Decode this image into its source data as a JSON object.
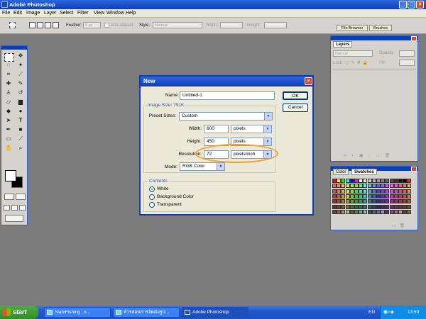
{
  "window": {
    "title": "Adobe Photoshop",
    "minimize": "_",
    "maximize": "□",
    "close": "×"
  },
  "menu": [
    "File",
    "Edit",
    "Image",
    "Layer",
    "Select",
    "Filter",
    "View",
    "Window",
    "Help"
  ],
  "options": {
    "feather_label": "Feather:",
    "feather_value": "0 px",
    "antialiased_label": "Anti-aliased",
    "style_label": "Style:",
    "style_value": "Normal",
    "width_label": "Width:",
    "height_label": "Height:",
    "tab_file_browser": "File Browser",
    "tab_brushes": "Brushes"
  },
  "dialog": {
    "title": "New",
    "name_label": "Name:",
    "name_value": "Untitled-1",
    "image_size_legend": "Image Size: 791K",
    "preset_label": "Preset Sizes:",
    "preset_value": "Custom",
    "width_label": "Width:",
    "width_value": "600",
    "width_unit": "pixels",
    "height_label": "Height:",
    "height_value": "450",
    "height_unit": "pixels",
    "resolution_label": "Resolution:",
    "resolution_value": "72",
    "resolution_unit": "pixels/inch",
    "mode_label": "Mode:",
    "mode_value": "RGB Color",
    "contents_legend": "Contents",
    "contents_options": [
      {
        "label": "White",
        "checked": true
      },
      {
        "label": "Background Color",
        "checked": false
      },
      {
        "label": "Transparent",
        "checked": false
      }
    ],
    "ok_label": "OK",
    "cancel_label": "Cancel"
  },
  "layers_palette": {
    "tab": "Layers",
    "blend_mode": "Normal",
    "opacity_label": "Opacity:",
    "lock_label": "Lock:",
    "fill_label": "Fill:"
  },
  "swatches_palette": {
    "tab_color": "Color",
    "tab_swatches": "Swatches"
  },
  "colors": {
    "accent": "#0a3fb8",
    "highlight": "#f0a030",
    "workspace": "#7c7c7c"
  },
  "taskbar": {
    "start": "start",
    "tasks": [
      {
        "label": "SiamFishing : n...",
        "active": false
      },
      {
        "label": "ทำรสอนการจัดต่อรูป...",
        "active": false
      },
      {
        "label": "Adobe Photoshop",
        "active": true
      }
    ],
    "lang": "EN",
    "clock": "13:59"
  }
}
